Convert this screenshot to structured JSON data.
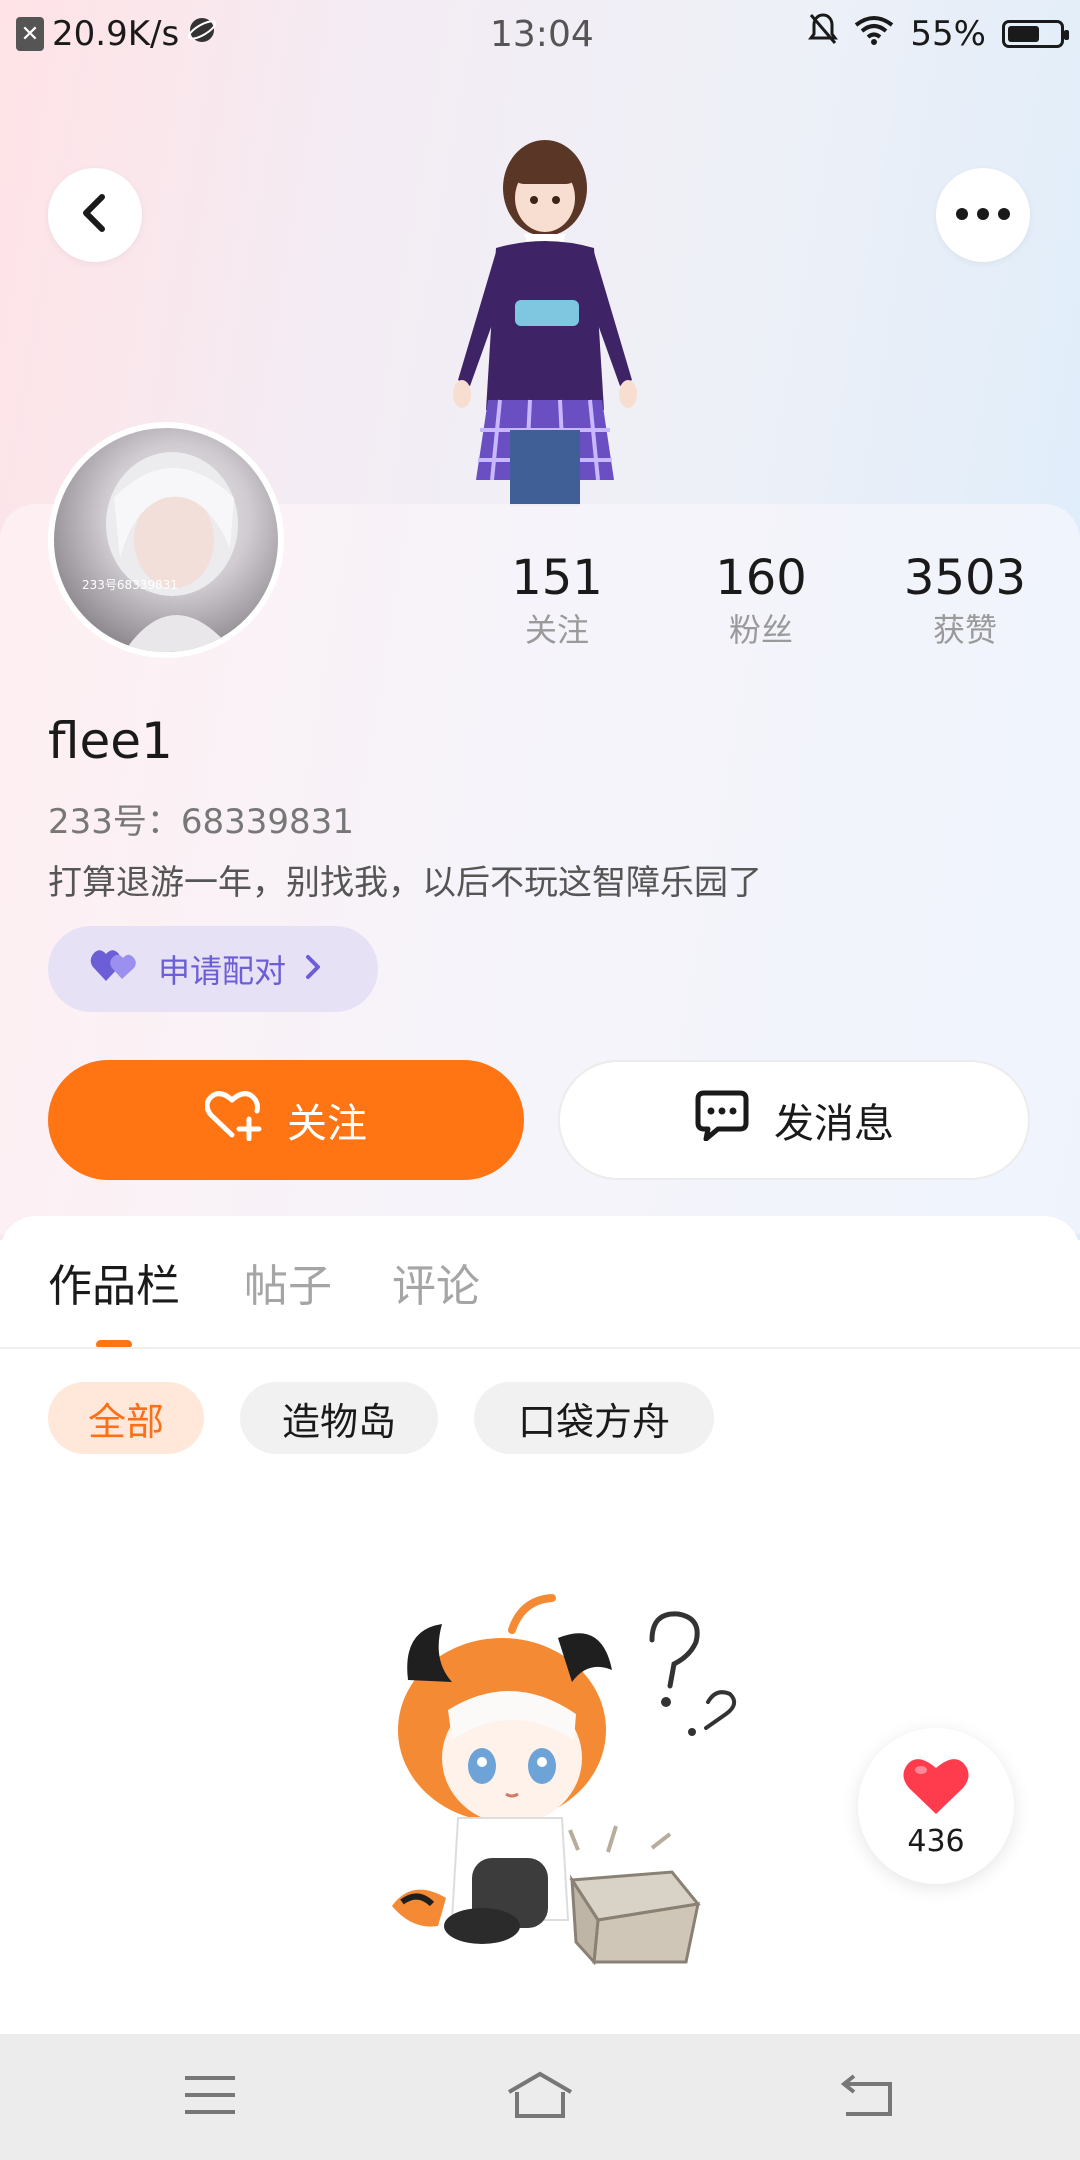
{
  "status_bar": {
    "speed": "20.9K/s",
    "time": "13:04",
    "battery": "55%"
  },
  "profile": {
    "username": "flee1",
    "uid": "233号：68339831",
    "bio": "打算退游一年，别找我，以后不玩这智障乐园了",
    "avatar_tag": "233号68339831",
    "stats": [
      {
        "value": "151",
        "label": "关注"
      },
      {
        "value": "160",
        "label": "粉丝"
      },
      {
        "value": "3503",
        "label": "获赞"
      }
    ]
  },
  "actions": {
    "pair_label": "申请配对",
    "follow_label": "关注",
    "message_label": "发消息"
  },
  "tabs": [
    "作品栏",
    "帖子",
    "评论"
  ],
  "filters": [
    "全部",
    "造物岛",
    "口袋方舟"
  ],
  "floating_like": {
    "count": "436"
  },
  "colors": {
    "accent": "#ff7413",
    "pair_purple": "#6c5ed6",
    "like_red": "#ff3b4e"
  },
  "icons": {
    "back": "chevron-left-icon",
    "more": "more-dots-icon",
    "pair": "double-heart-icon",
    "follow": "heart-plus-icon",
    "message": "chat-bubble-icon",
    "like": "heart-icon",
    "nav": [
      "menu-icon",
      "home-icon",
      "back-arrow-icon"
    ]
  }
}
